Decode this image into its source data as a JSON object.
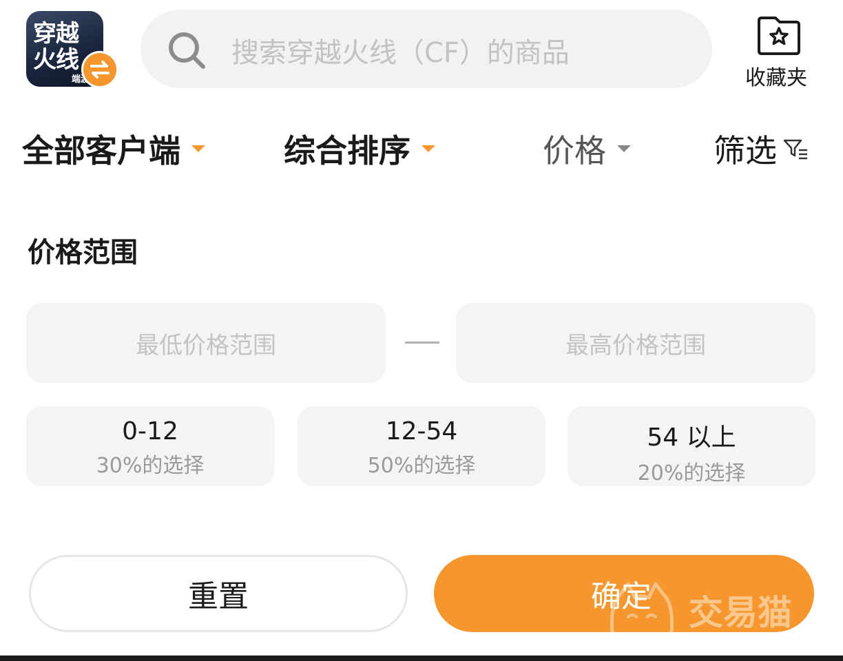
{
  "app": {
    "icon_line1": "穿越",
    "icon_line2": "火线",
    "icon_line3": "端游",
    "badge_icon": "swap-arrows-icon"
  },
  "search": {
    "placeholder": "搜索穿越火线（CF）的商品",
    "icon": "search-icon"
  },
  "favorites": {
    "label": "收藏夹",
    "icon": "star-folder-icon"
  },
  "filters": {
    "client": "全部客户端",
    "sort": "综合排序",
    "price": "价格",
    "filter": "筛选"
  },
  "price_panel": {
    "title": "价格范围",
    "min_placeholder": "最低价格范围",
    "max_placeholder": "最高价格范围",
    "ranges": [
      {
        "label": "0-12",
        "share": "30%的选择"
      },
      {
        "label": "12-54",
        "share": "50%的选择"
      },
      {
        "label": "54 以上",
        "share": "20%的选择"
      }
    ]
  },
  "actions": {
    "reset": "重置",
    "confirm": "确定"
  },
  "watermark": {
    "text": "交易猫"
  },
  "colors": {
    "accent": "#f5972e",
    "input_bg": "#f4f4f4",
    "placeholder": "#c3c3c3"
  }
}
